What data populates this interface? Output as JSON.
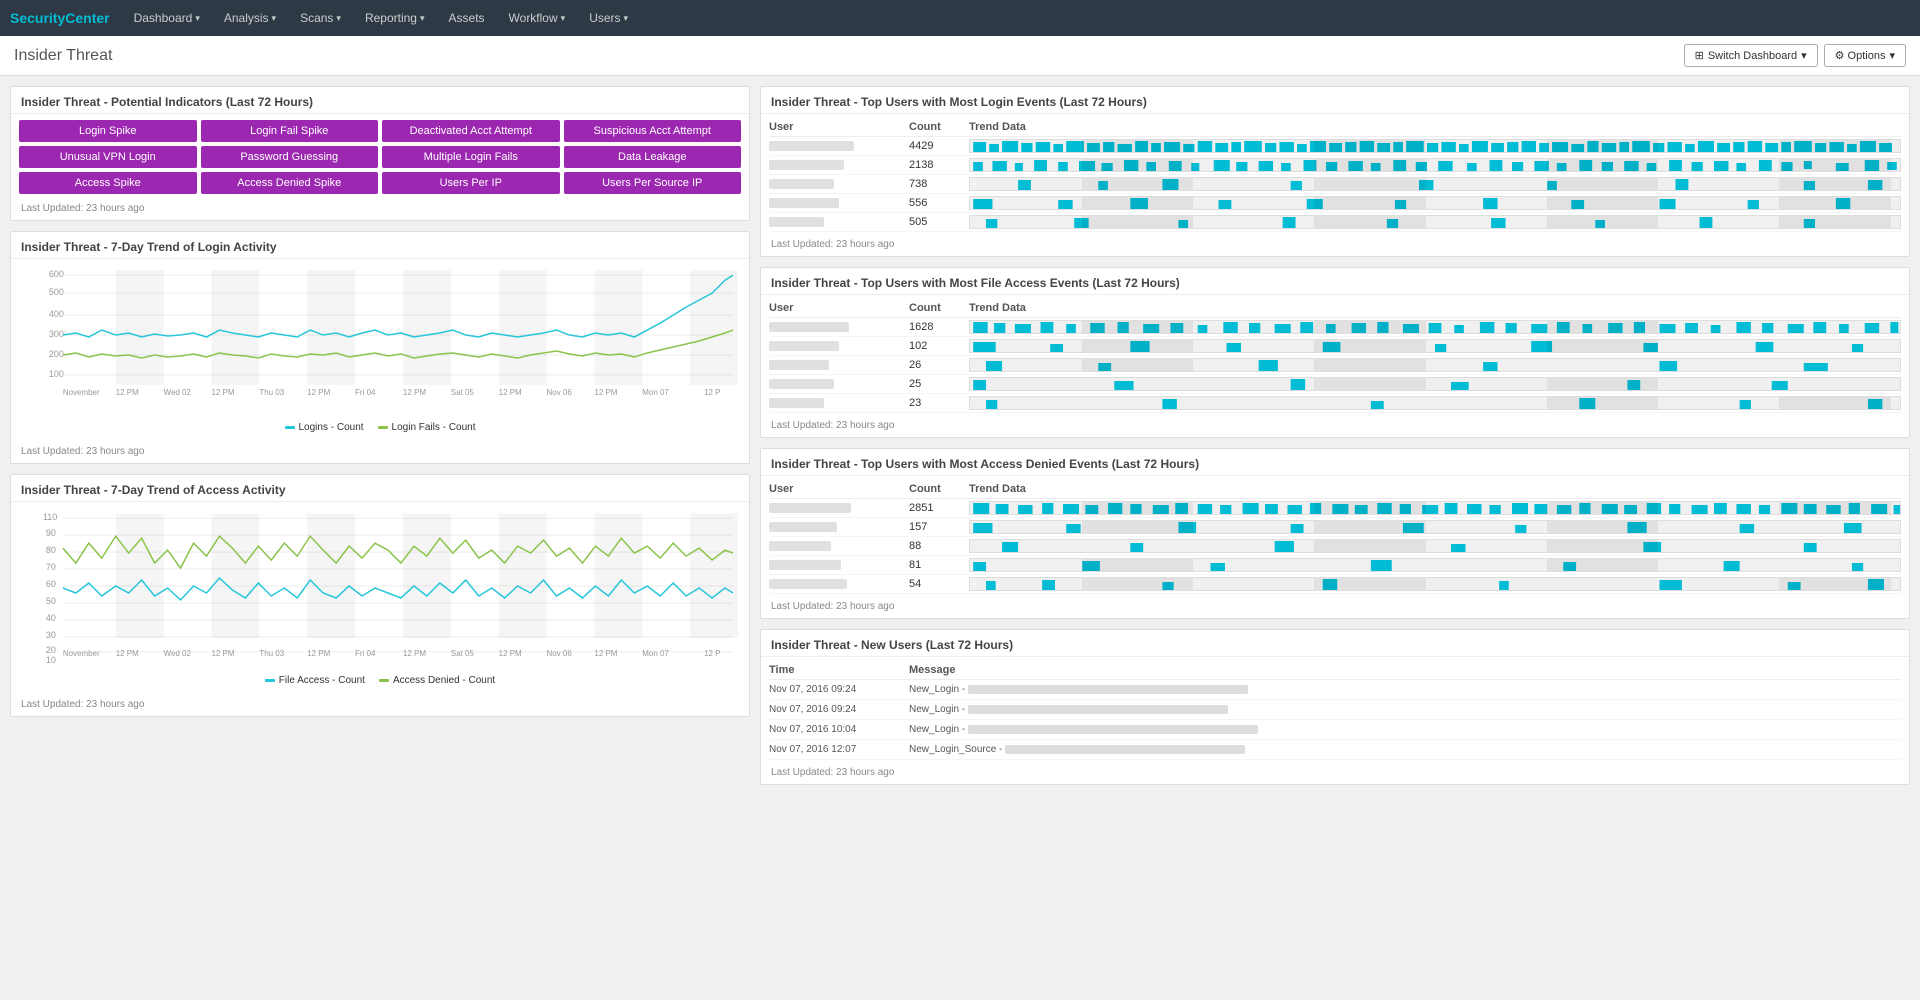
{
  "app": {
    "brand": "SecurityCenter"
  },
  "navbar": {
    "items": [
      {
        "label": "Dashboard",
        "has_arrow": true
      },
      {
        "label": "Analysis",
        "has_arrow": true
      },
      {
        "label": "Scans",
        "has_arrow": true
      },
      {
        "label": "Reporting",
        "has_arrow": true
      },
      {
        "label": "Assets",
        "has_arrow": false
      },
      {
        "label": "Workflow",
        "has_arrow": true
      },
      {
        "label": "Users",
        "has_arrow": true
      }
    ]
  },
  "page": {
    "title": "Insider Threat",
    "switch_btn": "Switch Dashboard",
    "options_btn": "⚙ Options"
  },
  "indicators": {
    "title": "Insider Threat - Potential Indicators (Last 72 Hours)",
    "last_updated": "Last Updated: 23 hours ago",
    "buttons": [
      "Login Spike",
      "Login Fail Spike",
      "Deactivated Acct Attempt",
      "Suspicious Acct Attempt",
      "Unusual VPN Login",
      "Password Guessing",
      "Multiple Login Fails",
      "Data Leakage",
      "Access Spike",
      "Access Denied Spike",
      "Users Per IP",
      "Users Per Source IP"
    ]
  },
  "login_trend": {
    "title": "Insider Threat - 7-Day Trend of Login Activity",
    "last_updated": "Last Updated: 23 hours ago",
    "legend": [
      {
        "label": "Logins - Count",
        "color": "#26c6da"
      },
      {
        "label": "Login Fails - Count",
        "color": "#8bc34a"
      }
    ],
    "y_labels": [
      "300",
      "500",
      "600",
      "400",
      "300",
      "200",
      "100"
    ],
    "x_labels": [
      "November",
      "12 PM",
      "Wed 02",
      "12 PM",
      "Thu 03",
      "12 PM",
      "Fri 04",
      "12 PM",
      "Sat 05",
      "12 PM",
      "Nov 06",
      "12 PM",
      "Mon 07",
      "12 P"
    ]
  },
  "access_trend": {
    "title": "Insider Threat - 7-Day Trend of Access Activity",
    "last_updated": "Last Updated: 23 hours ago",
    "legend": [
      {
        "label": "File Access - Count",
        "color": "#26c6da"
      },
      {
        "label": "Access Denied - Count",
        "color": "#8bc34a"
      }
    ],
    "y_labels": [
      "110",
      "90",
      "80",
      "70",
      "60",
      "50",
      "40",
      "30",
      "20",
      "10"
    ]
  },
  "top_login": {
    "title": "Insider Threat - Top Users with Most Login Events (Last 72 Hours)",
    "last_updated": "Last Updated: 23 hours ago",
    "headers": [
      "User",
      "Count",
      "Trend Data"
    ],
    "rows": [
      {
        "count": "4429"
      },
      {
        "count": "2138"
      },
      {
        "count": "738"
      },
      {
        "count": "556"
      },
      {
        "count": "505"
      }
    ]
  },
  "top_file": {
    "title": "Insider Threat - Top Users with Most File Access Events (Last 72 Hours)",
    "last_updated": "Last Updated: 23 hours ago",
    "headers": [
      "User",
      "Count",
      "Trend Data"
    ],
    "rows": [
      {
        "count": "1628"
      },
      {
        "count": "102"
      },
      {
        "count": "26"
      },
      {
        "count": "25"
      },
      {
        "count": "23"
      }
    ]
  },
  "top_denied": {
    "title": "Insider Threat - Top Users with Most Access Denied Events (Last 72 Hours)",
    "last_updated": "Last Updated: 23 hours ago",
    "headers": [
      "User",
      "Count",
      "Trend Data"
    ],
    "rows": [
      {
        "count": "2851"
      },
      {
        "count": "157"
      },
      {
        "count": "88"
      },
      {
        "count": "81"
      },
      {
        "count": "54"
      }
    ]
  },
  "new_users": {
    "title": "Insider Threat - New Users (Last 72 Hours)",
    "last_updated": "Last Updated: 23 hours ago",
    "headers": [
      "Time",
      "Message"
    ],
    "rows": [
      {
        "time": "Nov 07, 2016 09:24",
        "msg_prefix": "New_Login -"
      },
      {
        "time": "Nov 07, 2016 09:24",
        "msg_prefix": "New_Login -"
      },
      {
        "time": "Nov 07, 2016 10:04",
        "msg_prefix": "New_Login -"
      },
      {
        "time": "Nov 07, 2016 12:07",
        "msg_prefix": "New_Login_Source -"
      }
    ]
  }
}
